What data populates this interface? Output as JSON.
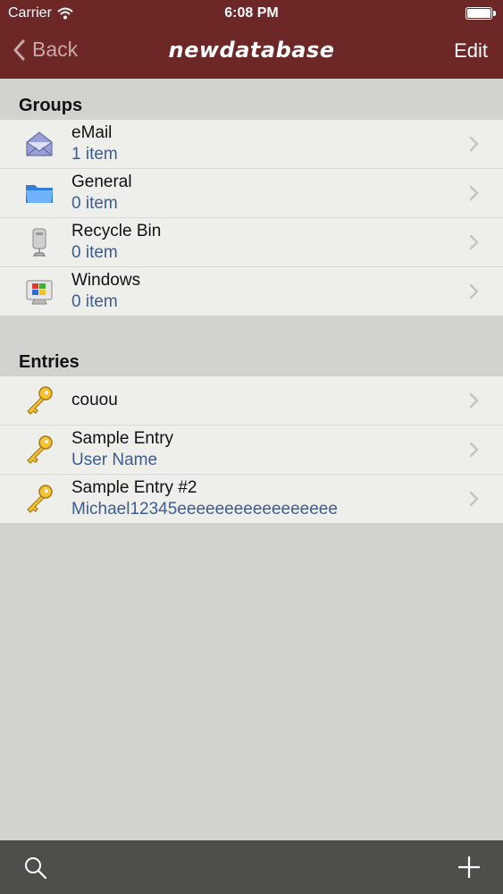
{
  "status_bar": {
    "carrier": "Carrier",
    "time": "6:08 PM"
  },
  "nav": {
    "back_label": "Back",
    "title": "newdatabase",
    "edit_label": "Edit"
  },
  "groups": {
    "header": "Groups",
    "items": [
      {
        "name": "eMail",
        "count": "1 item",
        "icon": "email-icon"
      },
      {
        "name": "General",
        "count": "0 item",
        "icon": "folder-icon"
      },
      {
        "name": "Recycle Bin",
        "count": "0 item",
        "icon": "recycle-bin-icon"
      },
      {
        "name": "Windows",
        "count": "0 item",
        "icon": "windows-icon"
      }
    ]
  },
  "entries": {
    "header": "Entries",
    "items": [
      {
        "title": "couou",
        "subtitle": "",
        "icon": "key-icon"
      },
      {
        "title": "Sample Entry",
        "subtitle": "User Name",
        "icon": "key-icon"
      },
      {
        "title": "Sample Entry #2",
        "subtitle": "Michael12345eeeeeeeeeeeeeeeee",
        "icon": "key-icon"
      }
    ]
  },
  "toolbar": {
    "icons": [
      "search-icon",
      "add-icon"
    ]
  },
  "colors": {
    "nav_bg": "#6d2726",
    "toolbar_bg": "#4e4e4a",
    "subtitle": "#3c5d92",
    "list_bg": "#eeeeeb",
    "page_bg": "#d2d2cf"
  }
}
